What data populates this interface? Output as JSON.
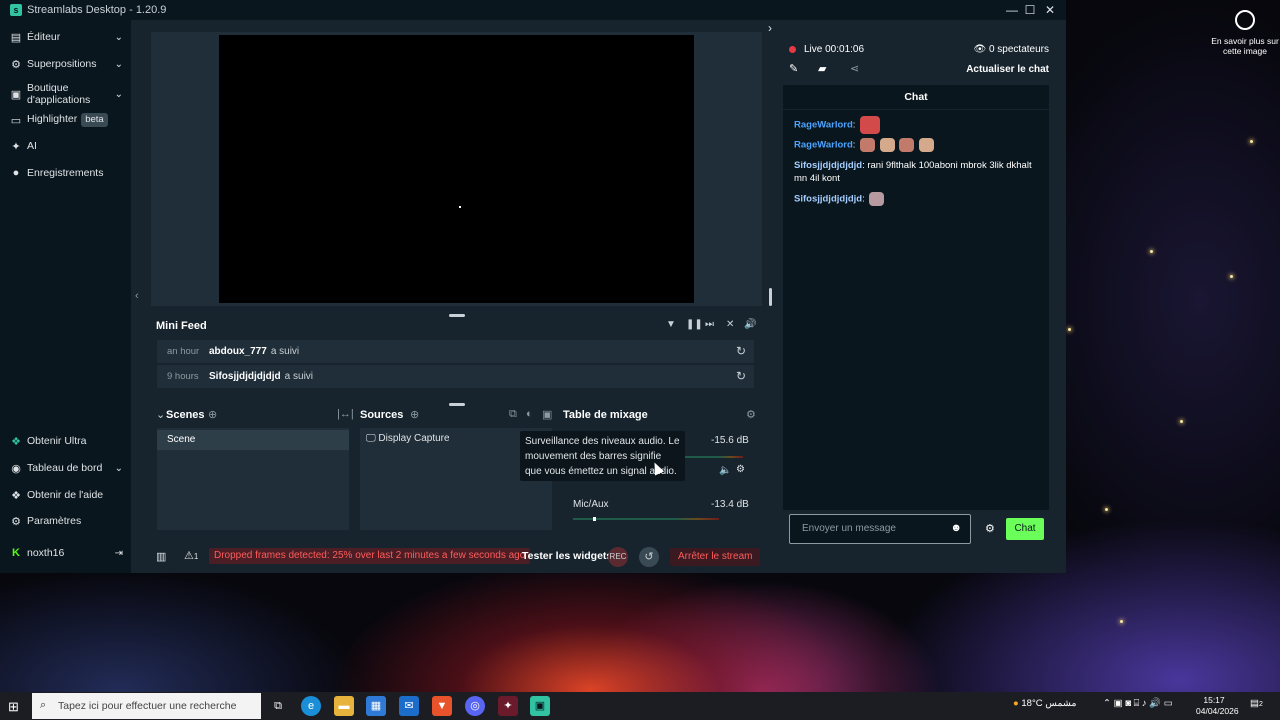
{
  "window": {
    "title": "Streamlabs Desktop - 1.20.9",
    "logo_letter": "s",
    "controls": {
      "minimize": "—",
      "maximize": "☐",
      "close": "✕"
    }
  },
  "sidebar": {
    "items": [
      {
        "label": "Éditeur",
        "icon": "editor-icon",
        "glyph": "▤",
        "chevron": "⌄"
      },
      {
        "label": "Superpositions",
        "icon": "overlays-icon",
        "glyph": "⚙",
        "chevron": "⌄"
      },
      {
        "label": "Boutique d'applications",
        "icon": "store-icon",
        "glyph": "▣",
        "chevron": "⌄"
      },
      {
        "label": "Highlighter",
        "icon": "highlighter-icon",
        "glyph": "▭",
        "badge": "beta"
      },
      {
        "label": "AI",
        "icon": "ai-icon",
        "glyph": "✦"
      },
      {
        "label": "Enregistrements",
        "icon": "recordings-icon",
        "glyph": "●"
      }
    ],
    "bottom_items": [
      {
        "label": "Obtenir Ultra",
        "icon": "ultra-icon",
        "glyph": "❖"
      },
      {
        "label": "Tableau de bord",
        "icon": "dashboard-icon",
        "glyph": "◉",
        "chevron": "⌄"
      },
      {
        "label": "Obtenir de l'aide",
        "icon": "help-icon",
        "glyph": "❖"
      },
      {
        "label": "Paramètres",
        "icon": "settings-icon",
        "glyph": "⚙"
      }
    ],
    "user": {
      "name": "noxth16",
      "logout_glyph": "⇥"
    },
    "collapse_glyph": "‹"
  },
  "minifeed": {
    "title": "Mini Feed",
    "controls": [
      "▼",
      "❚❚",
      "⏭",
      "✕",
      "🔊"
    ],
    "rows": [
      {
        "time": "an hour",
        "user": "abdoux_777",
        "action": "a suivi"
      },
      {
        "time": "9 hours",
        "user": "Sifosjjdjdjdjdjd",
        "action": "a suivi"
      }
    ],
    "replay_glyph": "↻"
  },
  "scenes": {
    "title": "Scenes",
    "add_glyph": "⊕",
    "items": [
      "Scene"
    ],
    "split_glyph": "|↔|"
  },
  "sources": {
    "title": "Sources",
    "add_glyph": "⊕",
    "items": [
      {
        "label": "Display Capture",
        "icon": "monitor-icon"
      }
    ]
  },
  "mixer": {
    "title": "Table de mixage",
    "tooltip": "Surveillance des niveaux audio. Le mouvement des barres signifie que vous émettez un signal audio.",
    "channels": [
      {
        "label": "",
        "db": "-15.6 dB",
        "level": 0.7
      },
      {
        "label": "Mic/Aux",
        "db": "-13.4 dB",
        "level": 0.12
      }
    ]
  },
  "footer": {
    "warning": "Dropped frames detected: 25% over last 2 minutes a few seconds ago",
    "alert_count": "1",
    "test_widgets": "Tester les widgets",
    "stop_stream": "Arrêter le stream"
  },
  "live": {
    "status": "Live 00:01:06",
    "viewers": "0 spectateurs",
    "refresh_chat": "Actualiser le chat",
    "chat_title": "Chat",
    "messages": [
      {
        "user": "RageWarlord",
        "text": "",
        "user_color": "#4da3ff",
        "emotes": 1
      },
      {
        "user": "RageWarlord",
        "text": "",
        "user_color": "#4da3ff",
        "emotes": 4
      },
      {
        "user": "Sifosjjdjdjdjdjd",
        "text": "rani 9flthalk 100aboni mbrok 3lik dkhalt mn 4il kont",
        "user_color": "#a6cdff",
        "emotes": 0
      },
      {
        "user": "Sifosjjdjdjdjdjd",
        "text": "",
        "user_color": "#a6cdff",
        "emotes": 1
      }
    ],
    "input_placeholder": "Envoyer un message",
    "send_label": "Chat"
  },
  "desktop_widget": {
    "text": "En savoir plus sur cette image"
  },
  "taskbar": {
    "search_placeholder": "Tapez ici pour effectuer une recherche",
    "weather": "18°C",
    "weather_label": "مشمس",
    "time": "15:17",
    "date": "04/04/2026",
    "notification_count": "2"
  }
}
